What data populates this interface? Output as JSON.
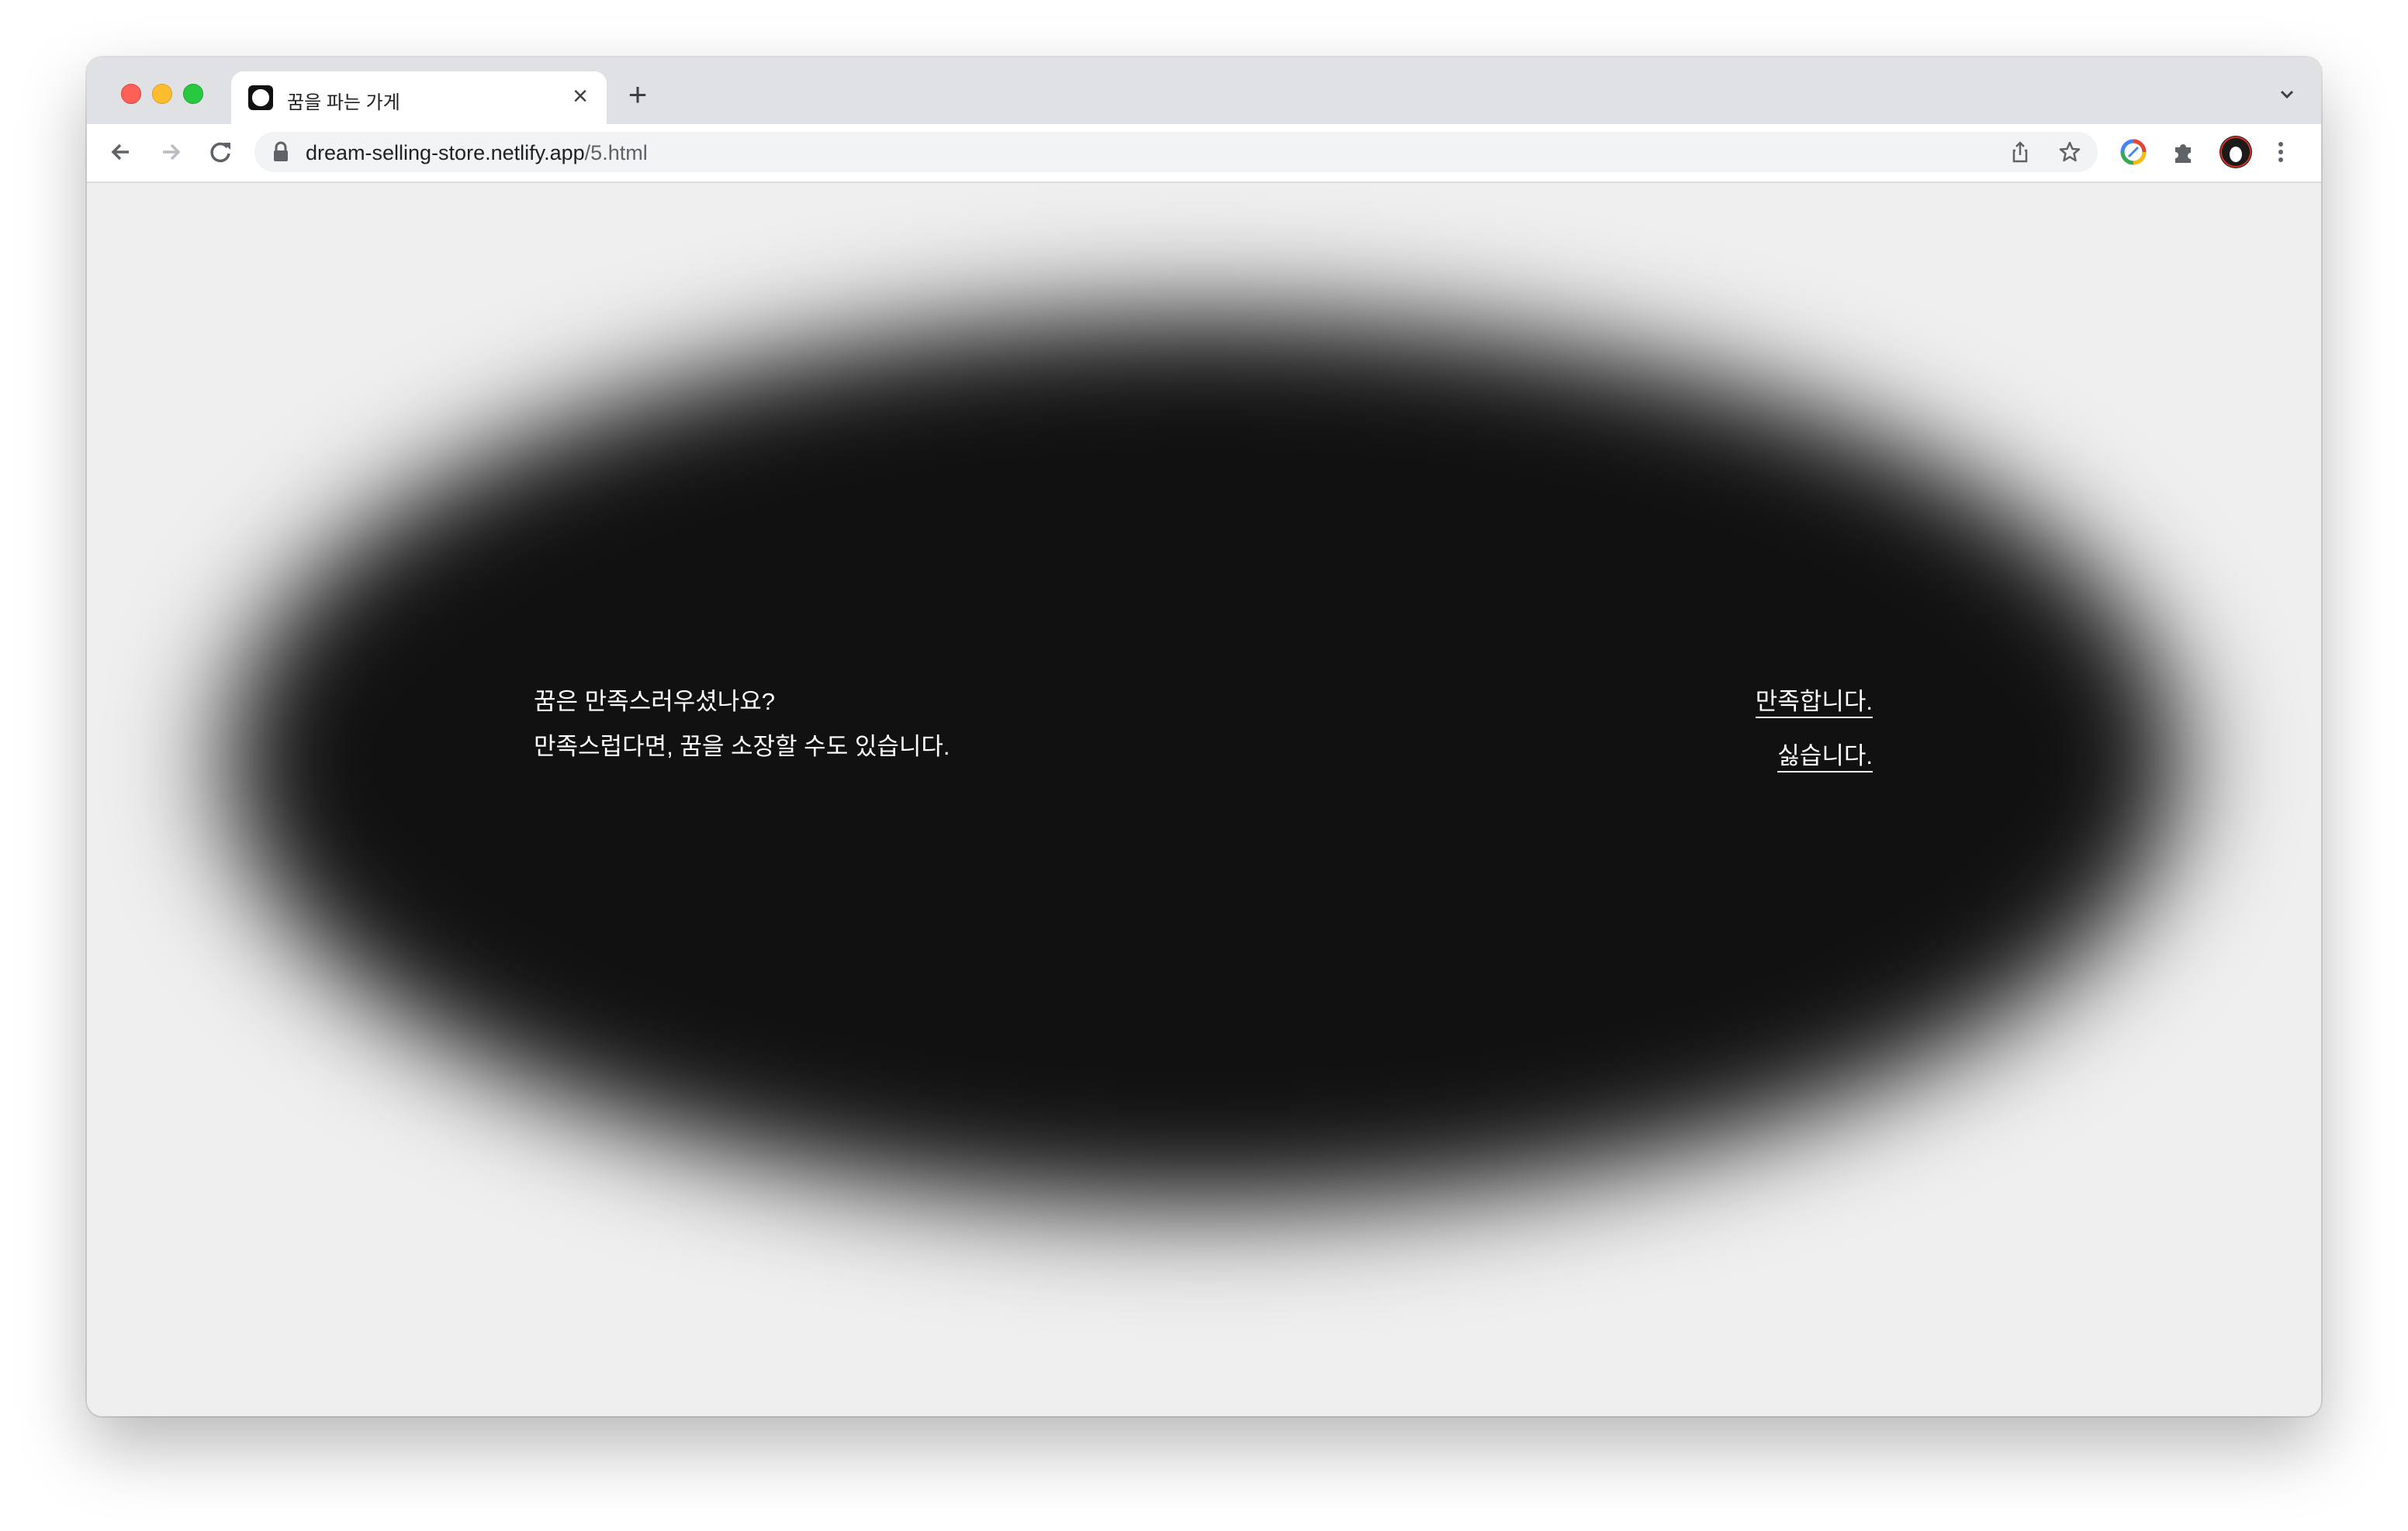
{
  "browser": {
    "tab": {
      "title": "꿈을 파는 가게",
      "close_glyph": "×",
      "favicon": "dream-favicon-icon"
    },
    "new_tab_glyph": "+",
    "address_bar": {
      "url_host": "dream-selling-store.netlify.app",
      "url_path": "/5.html",
      "icon": "lock-icon"
    },
    "toolbar_icons": [
      "back-icon",
      "forward-icon",
      "reload-icon",
      "share-icon",
      "bookmark-star-icon",
      "extension-colorful-icon",
      "extensions-puzzle-icon",
      "profile-avatar-icon",
      "more-menu-icon"
    ]
  },
  "page": {
    "question_line1": "꿈은 만족스러우셨나요?",
    "question_line2": "만족스럽다면, 꿈을 소장할 수도 있습니다.",
    "answer_yes": "만족합니다.",
    "answer_no": "싫습니다."
  },
  "colors": {
    "page_background": "#efefef",
    "dream_blob": "#111111",
    "text": "#ffffff"
  }
}
